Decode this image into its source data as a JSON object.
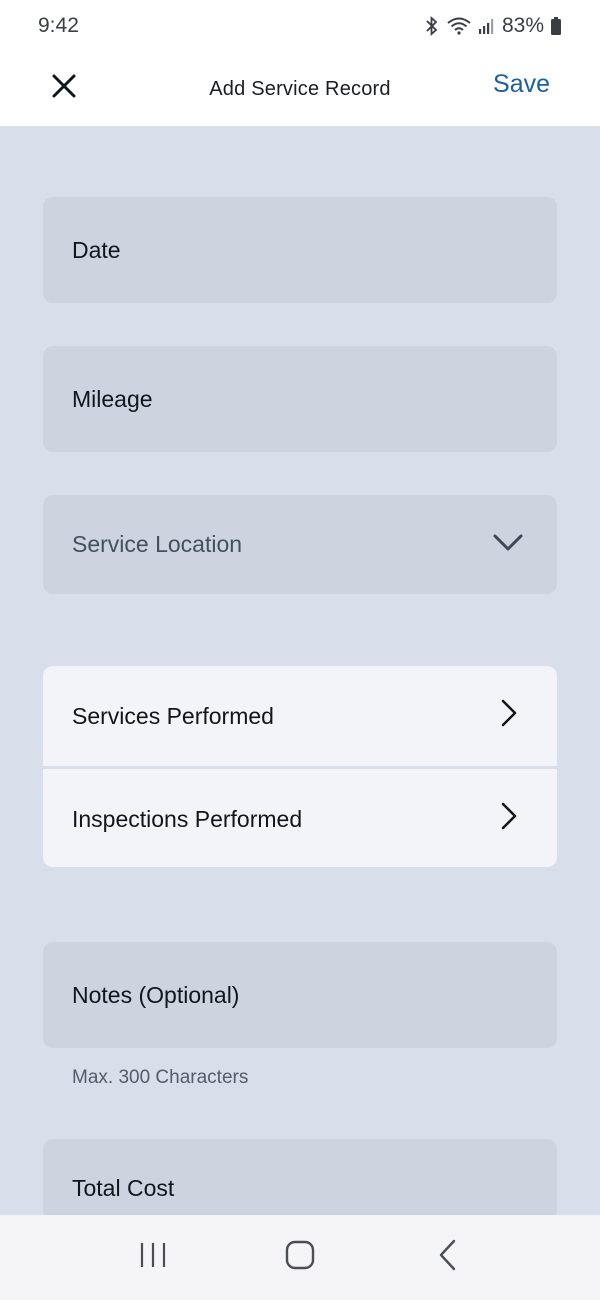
{
  "status_bar": {
    "time": "9:42",
    "battery": "83%",
    "icons": [
      "bluetooth-icon",
      "wifi-icon",
      "signal-icon",
      "battery-icon"
    ]
  },
  "header": {
    "close_icon": "close-icon",
    "title": "Add Service Record",
    "save_label": "Save"
  },
  "form": {
    "date_label": "Date",
    "mileage_label": "Mileage",
    "service_location_label": "Service Location",
    "services_performed_label": "Services Performed",
    "inspections_performed_label": "Inspections Performed",
    "notes_label": "Notes (Optional)",
    "notes_helper": "Max. 300 Characters",
    "total_cost_label": "Total Cost"
  },
  "colors": {
    "background": "#d9dfea",
    "field": "#cdd4df",
    "card": "#f2f4f9",
    "accent": "#1c5fa3"
  }
}
